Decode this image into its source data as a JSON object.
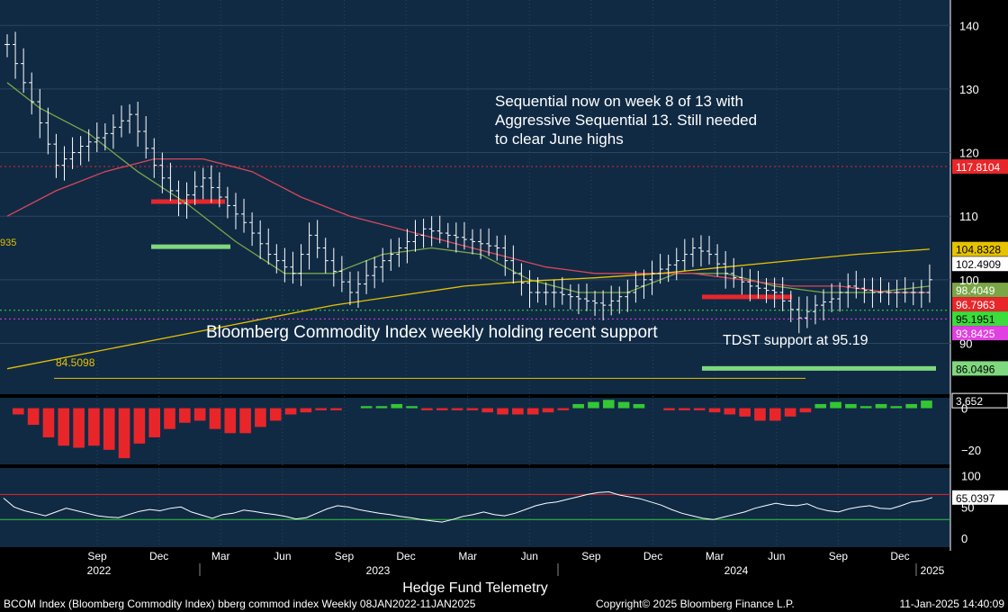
{
  "chart_data": {
    "type": "ohlc",
    "title": "Bloomberg Commodity Index weekly holding recent support",
    "comment_lines": [
      "Sequential now on week 8 of 13 with",
      "Aggressive Sequential 13.  Still needed",
      "to clear June highs"
    ],
    "support_label": "TDST support at 95.19",
    "left_levels": [
      "84.5098",
      "935"
    ],
    "price_axis": {
      "ticks": [
        90,
        100,
        110,
        120,
        130,
        140
      ],
      "range": [
        82,
        144
      ]
    },
    "x_axis": {
      "months": [
        "Sep",
        "Dec",
        "Mar",
        "Jun",
        "Sep",
        "Dec",
        "Mar",
        "Jun",
        "Sep",
        "Dec",
        "Mar",
        "Jun",
        "Sep",
        "Dec"
      ],
      "years": [
        "2022",
        "2023",
        "2024",
        "2025"
      ]
    },
    "price_path": [
      [
        0,
        137
      ],
      [
        3,
        128
      ],
      [
        6,
        118
      ],
      [
        9,
        121
      ],
      [
        12,
        123
      ],
      [
        15,
        126
      ],
      [
        18,
        118
      ],
      [
        21,
        112
      ],
      [
        24,
        116
      ],
      [
        26,
        113
      ],
      [
        29,
        109
      ],
      [
        32,
        104
      ],
      [
        35,
        101
      ],
      [
        37,
        107
      ],
      [
        39,
        103
      ],
      [
        42,
        98
      ],
      [
        45,
        102
      ],
      [
        48,
        105
      ],
      [
        51,
        108
      ],
      [
        54,
        107
      ],
      [
        57,
        106
      ],
      [
        60,
        105
      ],
      [
        62,
        101
      ],
      [
        64,
        98
      ],
      [
        67,
        98
      ],
      [
        70,
        97
      ],
      [
        73,
        96
      ],
      [
        76,
        98
      ],
      [
        79,
        101
      ],
      [
        82,
        103
      ],
      [
        84,
        105
      ],
      [
        86,
        104
      ],
      [
        88,
        101
      ],
      [
        91,
        99
      ],
      [
        94,
        98
      ],
      [
        97,
        94
      ],
      [
        99,
        96
      ],
      [
        101,
        97
      ],
      [
        103,
        99
      ],
      [
        106,
        98
      ],
      [
        109,
        98
      ],
      [
        112,
        98
      ],
      [
        113,
        100
      ]
    ],
    "series": [
      {
        "name": "MA short",
        "color": "#7aa646",
        "values": [
          [
            0,
            131
          ],
          [
            4,
            127
          ],
          [
            10,
            123
          ],
          [
            16,
            117
          ],
          [
            22,
            112
          ],
          [
            28,
            106
          ],
          [
            34,
            101
          ],
          [
            40,
            101
          ],
          [
            46,
            104
          ],
          [
            52,
            105
          ],
          [
            58,
            104
          ],
          [
            64,
            100
          ],
          [
            70,
            98
          ],
          [
            76,
            98
          ],
          [
            82,
            101
          ],
          [
            88,
            101
          ],
          [
            94,
            99
          ],
          [
            100,
            98
          ],
          [
            106,
            98
          ],
          [
            113,
            99
          ]
        ]
      },
      {
        "name": "MA mid",
        "color": "#d9475a",
        "values": [
          [
            0,
            110
          ],
          [
            6,
            114
          ],
          [
            12,
            117
          ],
          [
            18,
            119
          ],
          [
            24,
            119
          ],
          [
            30,
            117
          ],
          [
            36,
            113
          ],
          [
            42,
            110
          ],
          [
            48,
            108
          ],
          [
            54,
            106
          ],
          [
            60,
            104
          ],
          [
            66,
            102
          ],
          [
            72,
            101
          ],
          [
            78,
            101
          ],
          [
            84,
            101
          ],
          [
            90,
            100
          ],
          [
            96,
            99
          ],
          [
            102,
            99
          ],
          [
            108,
            98
          ],
          [
            113,
            98
          ]
        ]
      },
      {
        "name": "MA long",
        "color": "#e6c200",
        "values": [
          [
            0,
            86
          ],
          [
            8,
            88
          ],
          [
            16,
            90
          ],
          [
            24,
            92
          ],
          [
            32,
            94
          ],
          [
            40,
            96
          ],
          [
            48,
            97.5
          ],
          [
            56,
            99
          ],
          [
            64,
            99.8
          ],
          [
            72,
            100.3
          ],
          [
            80,
            101
          ],
          [
            88,
            102
          ],
          [
            96,
            103
          ],
          [
            104,
            104
          ],
          [
            113,
            104.8
          ]
        ]
      }
    ],
    "levels": [
      {
        "value": 117.8104,
        "label": "117.8104",
        "color": "#e8262a",
        "style": "dotted"
      },
      {
        "value": 104.8328,
        "label": "104.8328",
        "color": "#e6c200",
        "style": "none"
      },
      {
        "value": 102.4909,
        "label": "102.4909",
        "color": "#ffffff",
        "style": "none"
      },
      {
        "value": 98.4049,
        "label": "98.4049",
        "color": "#7aa646",
        "style": "none"
      },
      {
        "value": 96.7963,
        "label": "96.7963",
        "color": "#e8262a",
        "style": "none"
      },
      {
        "value": 95.1951,
        "label": "95.1951",
        "color": "#3bdc3b",
        "style": "dotted"
      },
      {
        "value": 93.8425,
        "label": "93.8425",
        "color": "#e040e0",
        "style": "dotted"
      },
      {
        "value": 86.0496,
        "label": "86.0496",
        "color": "#7fd87f",
        "style": "none"
      }
    ],
    "histogram": {
      "label": "3.652",
      "ticks": [
        0,
        -20
      ],
      "range": [
        -27,
        5
      ],
      "values": [
        -3,
        -8,
        -14,
        -18,
        -19,
        -18,
        -20,
        -24,
        -17,
        -14,
        -10,
        -7,
        -6,
        -10,
        -12,
        -12,
        -9,
        -6,
        -3,
        -2,
        -1,
        -1,
        0,
        1,
        1,
        2,
        1,
        -1,
        -1,
        -1,
        -1,
        -2,
        -3,
        -3,
        -3,
        -2,
        -1,
        2,
        3,
        4,
        3,
        2,
        0,
        -1,
        -1,
        -1,
        -2,
        -3,
        -4,
        -6,
        -6,
        -4,
        -2,
        2,
        3,
        2,
        1,
        2,
        1,
        2,
        3.652
      ]
    },
    "oscillator": {
      "label": "65.0397",
      "ticks": [
        100,
        50,
        0
      ],
      "range": [
        -14,
        112
      ],
      "upper": 70,
      "lower": 30,
      "values": [
        64,
        50,
        44,
        40,
        36,
        42,
        48,
        44,
        40,
        36,
        34,
        33,
        38,
        43,
        46,
        44,
        48,
        50,
        42,
        37,
        32,
        38,
        40,
        45,
        43,
        40,
        38,
        35,
        31,
        33,
        40,
        47,
        52,
        50,
        46,
        43,
        40,
        38,
        35,
        33,
        30,
        28,
        26,
        30,
        35,
        38,
        42,
        38,
        36,
        40,
        46,
        52,
        56,
        58,
        62,
        66,
        70,
        73,
        74,
        69,
        66,
        63,
        58,
        53,
        46,
        40,
        36,
        32,
        30,
        34,
        38,
        42,
        48,
        52,
        56,
        53,
        52,
        55,
        48,
        44,
        42,
        47,
        50,
        52,
        48,
        47,
        52,
        58,
        60,
        65.04
      ]
    }
  },
  "footer": {
    "center_title": "Hedge Fund Telemetry",
    "left": "BCOM Index (Bloomberg Commodity Index) bberg commod index  Weekly 08JAN2022-11JAN2025",
    "middle": "Copyright© 2025 Bloomberg Finance L.P.",
    "right": "11-Jan-2025 14:40:09"
  },
  "colors": {
    "panel_bg": "#102a44",
    "page_bg": "#000000",
    "grid": "#2c4560",
    "text": "#ffffff",
    "hist_neg": "#e8262a",
    "hist_pos": "#34c734"
  }
}
